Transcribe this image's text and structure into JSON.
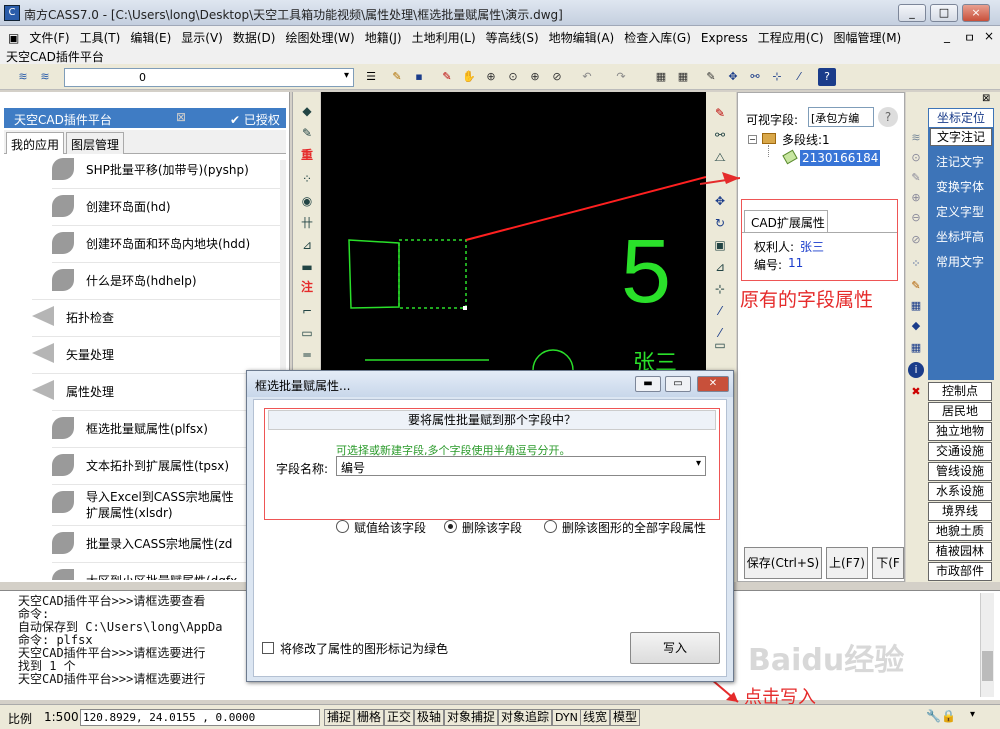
{
  "window": {
    "title": "南方CASS7.0 - [C:\\Users\\long\\Desktop\\天空工具箱功能视频\\属性处理\\框选批量赋属性\\演示.dwg]",
    "buttons": [
      "_",
      "□",
      "×"
    ]
  },
  "menu": {
    "items": [
      "文件(F)",
      "工具(T)",
      "编辑(E)",
      "显示(V)",
      "数据(D)",
      "绘图处理(W)",
      "地籍(J)",
      "土地利用(L)",
      "等高线(S)",
      "地物编辑(A)",
      "检查入库(G)",
      "Express",
      "工程应用(C)",
      "图幅管理(M)"
    ],
    "platform_line": "天空CAD插件平台",
    "doc_buttons": [
      "_",
      "ㅁ",
      "×"
    ]
  },
  "toolbar": {
    "layer_value": "0"
  },
  "left_panel": {
    "title": "天空CAD插件平台",
    "authorized": "已授权",
    "tabs": [
      "我的应用",
      "图层管理"
    ],
    "items": [
      {
        "label": "SHP批量平移(加带号)(pyshp)",
        "icon": "leaf-icon",
        "sub": true
      },
      {
        "label": "创建环岛面(hd)",
        "icon": "leaf-icon",
        "sub": true
      },
      {
        "label": "创建环岛面和环岛内地块(hdd)",
        "icon": "leaf-icon",
        "sub": true
      },
      {
        "label": "什么是环岛(hdhelp)",
        "icon": "leaf-icon",
        "sub": true
      },
      {
        "label": "拓扑检查",
        "icon": "send-icon",
        "sub": false
      },
      {
        "label": "矢量处理",
        "icon": "send-icon",
        "sub": false
      },
      {
        "label": "属性处理",
        "icon": "send-icon",
        "sub": false
      },
      {
        "label": "框选批量赋属性(plfsx)",
        "icon": "leaf-icon",
        "sub": true
      },
      {
        "label": "文本拓扑到扩展属性(tpsx)",
        "icon": "leaf-icon",
        "sub": true
      },
      {
        "label": "导入Excel到CASS宗地属性\n扩展属性(xlsdr)",
        "icon": "leaf-icon",
        "sub": true
      },
      {
        "label": "批量录入CASS宗地属性(zd",
        "icon": "leaf-icon",
        "sub": true
      },
      {
        "label": "大区到小区批量赋属性(dqfx",
        "icon": "leaf-icon",
        "sub": true
      }
    ]
  },
  "left_toolbar": {
    "red_labels": [
      "重",
      "注"
    ]
  },
  "canvas": {
    "number_text": "5",
    "name_text": "张三"
  },
  "property_panel": {
    "visible_field_label": "可视字段:",
    "visible_field_value": "[承包方编",
    "tree_root": "多段线:1",
    "tree_child": "2130166184",
    "cad_ext_header": "CAD扩展属性",
    "fields": [
      {
        "key": "权利人:",
        "value": "张三"
      },
      {
        "key": "编号:",
        "value": "11"
      }
    ],
    "annotation": "原有的字段属性",
    "buttons": [
      "保存(Ctrl+S)",
      "上(F7)",
      "下(F"
    ]
  },
  "right_panel": {
    "blue_buttons": [
      "坐标定位",
      "文字注记",
      "注记文字",
      "变换字体",
      "定义字型",
      "坐标坪高",
      "常用文字"
    ],
    "buttons": [
      "控制点",
      "居民地",
      "独立地物",
      "交通设施",
      "管线设施",
      "水系设施",
      "境界线",
      "地貌土质",
      "植被园林",
      "市政部件"
    ]
  },
  "command": {
    "lines": [
      "天空CAD插件平台>>>请框选要查看",
      "命令:",
      "自动保存到 C:\\Users\\long\\AppDa",
      "命令: plfsx",
      "天空CAD插件平台>>>请框选要进行",
      "找到 1 个",
      "天空CAD插件平台>>>请框选要进行"
    ],
    "annotation": "点击写入",
    "watermark": "Baidu经验"
  },
  "status": {
    "scale_label": "比例",
    "scale": "1:500",
    "coords": "120.8929, 24.0155  , 0.0000",
    "toggles": [
      "捕捉",
      "栅格",
      "正交",
      "极轴",
      "对象捕捉",
      "对象追踪",
      "DYN",
      "线宽",
      "模型"
    ]
  },
  "dialog": {
    "title": "框选批量赋属性...",
    "heading": "要将属性批量赋到那个字段中？",
    "hint": "可选择或新建字段,多个字段使用半角逗号分开。",
    "field_label": "字段名称:",
    "field_value": "编号",
    "options": [
      "赋值给该字段",
      "删除该字段",
      "删除该图形的全部字段属性"
    ],
    "selected_option": "删除该字段",
    "mark_checkbox": "将修改了属性的图形标记为绿色",
    "write_button": "写入"
  }
}
